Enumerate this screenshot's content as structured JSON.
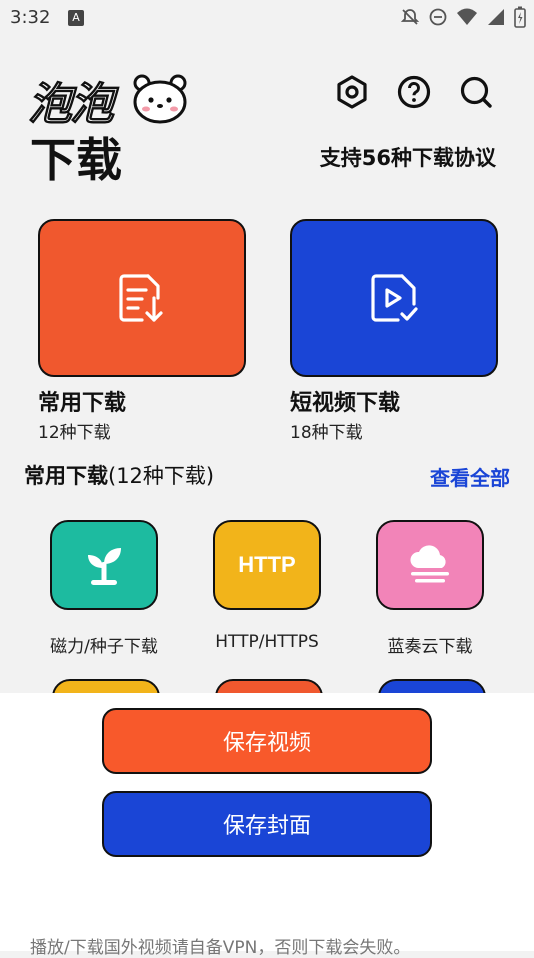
{
  "status_bar": {
    "time": "3:32",
    "icons": [
      "notification-icon",
      "dnd-off-icon",
      "minus-circle-icon",
      "wifi-icon",
      "signal-icon",
      "battery-icon"
    ]
  },
  "header": {
    "logo_top": "泡泡",
    "logo_bottom": "下载",
    "icons": [
      "settings-icon",
      "help-icon",
      "search-icon"
    ],
    "protocol_text": "支持56种下载协议"
  },
  "cards": {
    "common": {
      "title": "常用下载",
      "sub": "12种下载",
      "color": "#f0582e"
    },
    "short_video": {
      "title": "短视频下载",
      "sub": "18种下载",
      "color": "#1a45d6"
    }
  },
  "section": {
    "title_bold": "常用下载",
    "title_rest": "(12种下载)",
    "view_all": "查看全部"
  },
  "protocols": [
    {
      "label": "磁力/种子下载",
      "icon": "sprout-icon",
      "color": "#1dbba0"
    },
    {
      "label": "HTTP/HTTPS",
      "icon": "http-icon",
      "icon_text": "HTTP",
      "color": "#f2b41a"
    },
    {
      "label": "蓝奏云下载",
      "icon": "cloud-icon",
      "color": "#f284b8"
    }
  ],
  "sheet": {
    "save_video": "保存视频",
    "save_cover": "保存封面",
    "notice": "播放/下载国外视频请自备VPN，否则下载会失败。"
  }
}
